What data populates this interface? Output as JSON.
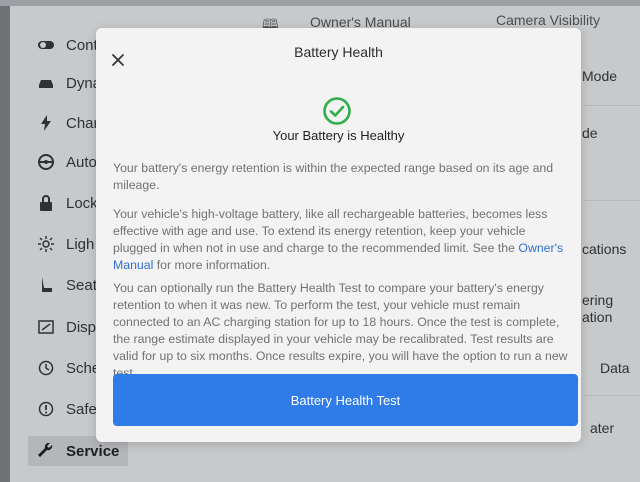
{
  "background": {
    "top_items": [
      "Owner's Manual",
      "Camera Visibility"
    ],
    "sidebar": [
      {
        "label": "Cont",
        "icon": "toggle-icon"
      },
      {
        "label": "Dyna",
        "icon": "car-icon"
      },
      {
        "label": "Char",
        "icon": "lightning-icon"
      },
      {
        "label": "Auto",
        "icon": "steering-wheel-icon"
      },
      {
        "label": "Lock",
        "icon": "lock-icon"
      },
      {
        "label": "Ligh",
        "icon": "light-icon"
      },
      {
        "label": "Seat",
        "icon": "seat-icon"
      },
      {
        "label": "Disp",
        "icon": "display-icon"
      },
      {
        "label": "Sche",
        "icon": "clock-icon"
      },
      {
        "label": "Safe",
        "icon": "info-icon"
      },
      {
        "label": "Service",
        "icon": "wrench-icon"
      }
    ],
    "active_sidebar_item": "Service",
    "right_column": [
      "Mode",
      "de",
      "cations",
      "ering",
      "ation",
      "Data",
      "ater"
    ]
  },
  "modal": {
    "title": "Battery Health",
    "close_label": "×",
    "status_title": "Your Battery is Healthy",
    "paragraph1": "Your battery's energy retention is within the expected range based on its age and mileage.",
    "paragraph2_before_link": "Your vehicle's high-voltage battery, like all rechargeable batteries, becomes less effective with age and use. To extend its energy retention, keep your vehicle plugged in when not in use and charge to the recommended limit. See the ",
    "paragraph2_link": "Owner's Manual",
    "paragraph2_after_link": " for more information.",
    "paragraph3": "You can optionally run the Battery Health Test to compare your battery's energy retention to when it was new. To perform the test, your vehicle must remain connected to an AC charging station for up to 18 hours. Once the test is complete, the range estimate displayed in your vehicle may be recalibrated. Test results are valid for up to six months. Once results expire, you will have the option to run a new test.",
    "button_label": "Battery Health Test"
  },
  "colors": {
    "accent": "#2f7be8",
    "link": "#2f6fd1",
    "success": "#2fae4a",
    "modal_bg": "#f3f3f3"
  }
}
